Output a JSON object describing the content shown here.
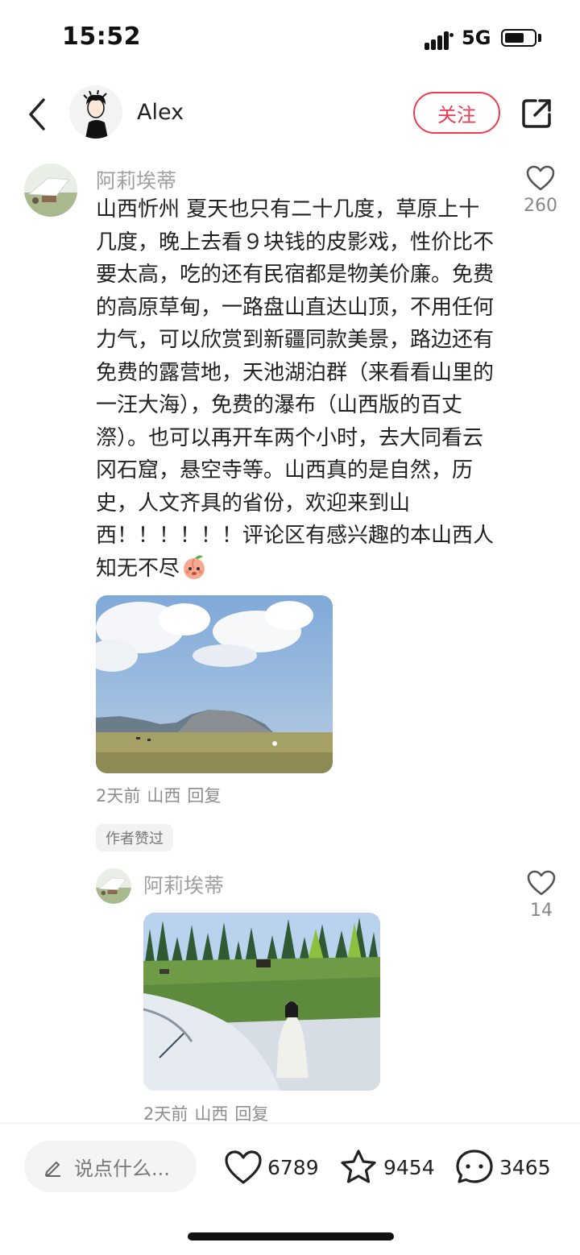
{
  "status_bar": {
    "time": "15:52",
    "network": "5G"
  },
  "header": {
    "user_name": "Alex",
    "follow_label": "关注"
  },
  "comment": {
    "author": "阿莉埃蒂",
    "lines": [
      "山西忻州  夏天也只有二十几度，草原上十",
      "几度，晚上去看９块钱的皮影戏，性价比不",
      "要太高，吃的还有民宿都是物美价廉。免费",
      "的高原草甸，一路盘山直达山顶，不用任何",
      "力气，可以欣赏到新疆同款美景，路边还有",
      "免费的露营地，天池湖泊群（来看看山里的",
      "一汪大海），免费的瀑布（山西版的百丈",
      "漈）。也可以再开车两个小时，去大同看云",
      "冈石窟，悬空寺等。山西真的是自然，历",
      "史，人文齐具的省份，欢迎来到山",
      "西！！！！！！评论区有感兴趣的本山西人",
      "知无不尽"
    ],
    "like_count": "260",
    "time": "2天前",
    "location": "山西",
    "reply_label": "回复",
    "author_liked_badge": "作者赞过"
  },
  "reply": {
    "author": "阿莉埃蒂",
    "like_count": "14",
    "time": "2天前",
    "location": "山西",
    "reply_label": "回复"
  },
  "bottom_bar": {
    "input_placeholder": "说点什么...",
    "likes": "6789",
    "favorites": "9454",
    "comments": "3465"
  },
  "colors": {
    "accent": "#ee3a52"
  }
}
